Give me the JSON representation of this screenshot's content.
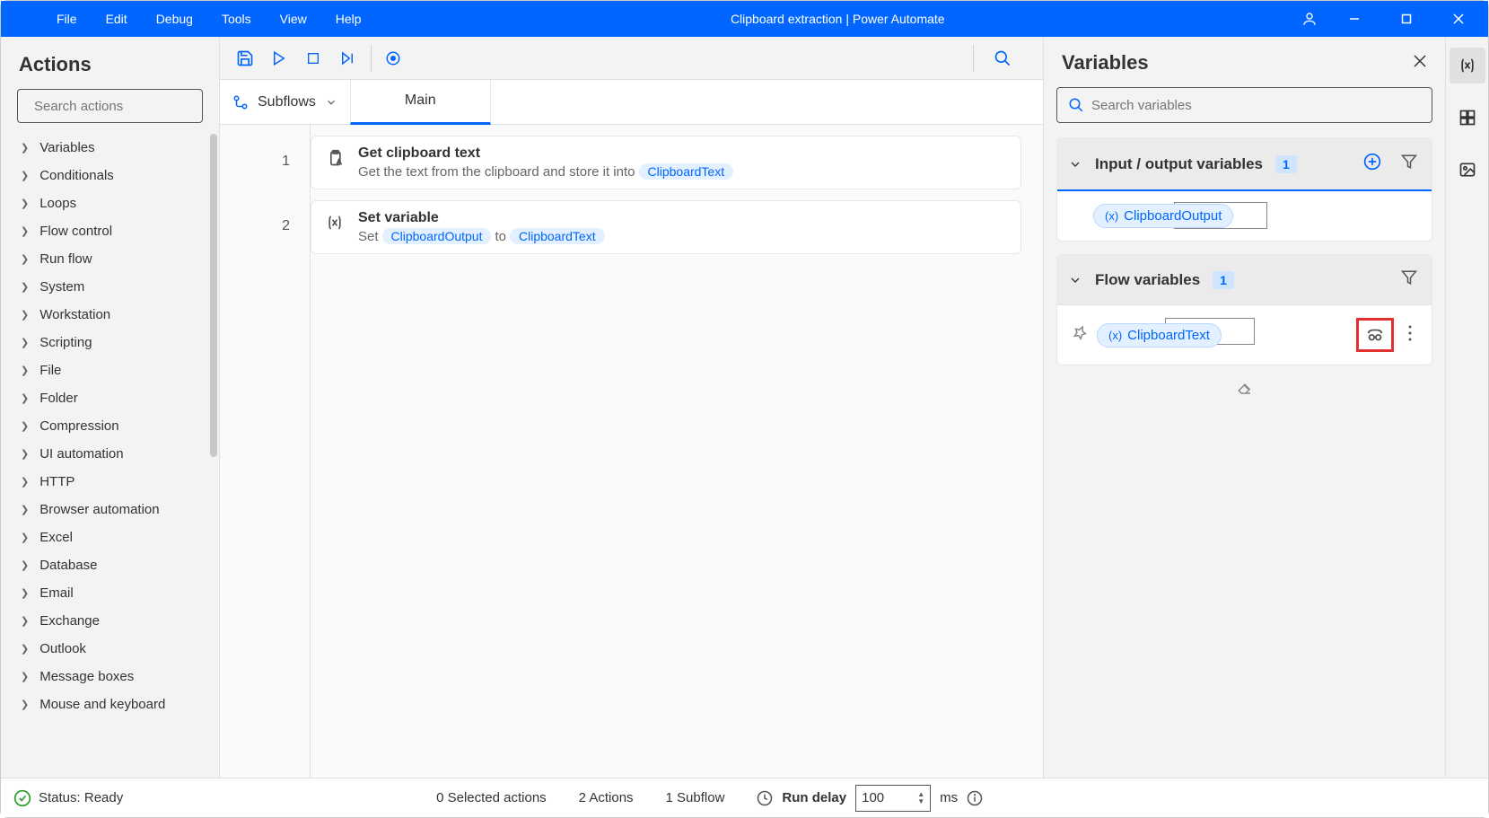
{
  "titlebar": {
    "menus": [
      "File",
      "Edit",
      "Debug",
      "Tools",
      "View",
      "Help"
    ],
    "title": "Clipboard extraction | Power Automate"
  },
  "actions_panel": {
    "header": "Actions",
    "search_placeholder": "Search actions",
    "categories": [
      "Variables",
      "Conditionals",
      "Loops",
      "Flow control",
      "Run flow",
      "System",
      "Workstation",
      "Scripting",
      "File",
      "Folder",
      "Compression",
      "UI automation",
      "HTTP",
      "Browser automation",
      "Excel",
      "Database",
      "Email",
      "Exchange",
      "Outlook",
      "Message boxes",
      "Mouse and keyboard"
    ]
  },
  "designer": {
    "subflows_label": "Subflows",
    "main_tab": "Main",
    "steps": [
      {
        "num": "1",
        "title": "Get clipboard text",
        "desc_prefix": "Get the text from the clipboard and store it into",
        "var1": "ClipboardText"
      },
      {
        "num": "2",
        "title": "Set variable",
        "set_label": "Set",
        "var1": "ClipboardOutput",
        "to_label": "to",
        "var2": "ClipboardText"
      }
    ]
  },
  "variables_panel": {
    "title": "Variables",
    "search_placeholder": "Search variables",
    "io_section": {
      "title": "Input / output variables",
      "count": "1",
      "var": "ClipboardOutput"
    },
    "flow_section": {
      "title": "Flow variables",
      "count": "1",
      "var": "ClipboardText"
    }
  },
  "statusbar": {
    "status": "Status: Ready",
    "selected": "0 Selected actions",
    "actions": "2 Actions",
    "subflows": "1 Subflow",
    "delay_label": "Run delay",
    "delay_value": "100",
    "delay_unit": "ms"
  }
}
